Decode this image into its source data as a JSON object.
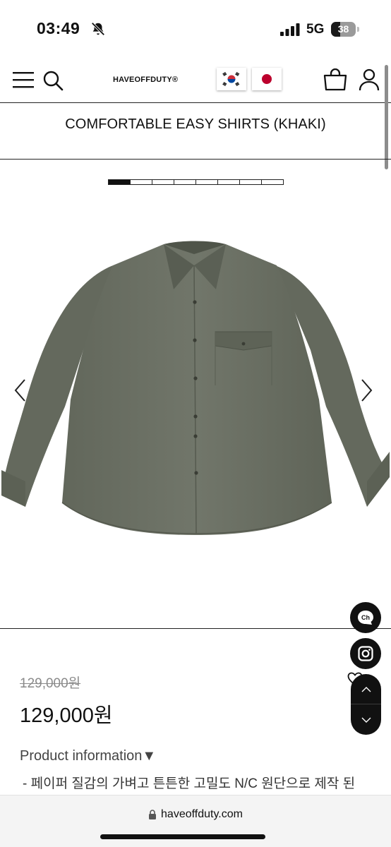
{
  "status_bar": {
    "time": "03:49",
    "network": "5G",
    "battery_level": "38",
    "battery_fraction": 0.38
  },
  "header": {
    "logo": "HAVEOFFDUTY®",
    "icons": [
      "menu-icon",
      "search-icon",
      "korea-flag-icon",
      "japan-flag-icon",
      "shopping-bag-icon",
      "user-icon"
    ]
  },
  "product": {
    "title": "COMFORTABLE EASY SHIRTS (KHAKI)",
    "slider_count": 8,
    "slider_active_index": 0,
    "image_color": "#6b7064",
    "price_original": "129,000원",
    "price_sale": "129,000원"
  },
  "info": {
    "heading": "Product information▼",
    "line1": "- 페이퍼 질감의 가벼고 튼튼한 고밀도 N/C 원단으로 제작 된"
  },
  "floating": {
    "channel_label": "Ch",
    "icons": [
      "channel-talk-icon",
      "instagram-icon",
      "heart-icon",
      "chevron-up-icon",
      "chevron-down-icon"
    ]
  },
  "browser": {
    "url": "haveoffduty.com"
  },
  "colors": {
    "text": "#111111",
    "muted": "#8a8a8a",
    "shirt_khaki": "#6b7064"
  }
}
